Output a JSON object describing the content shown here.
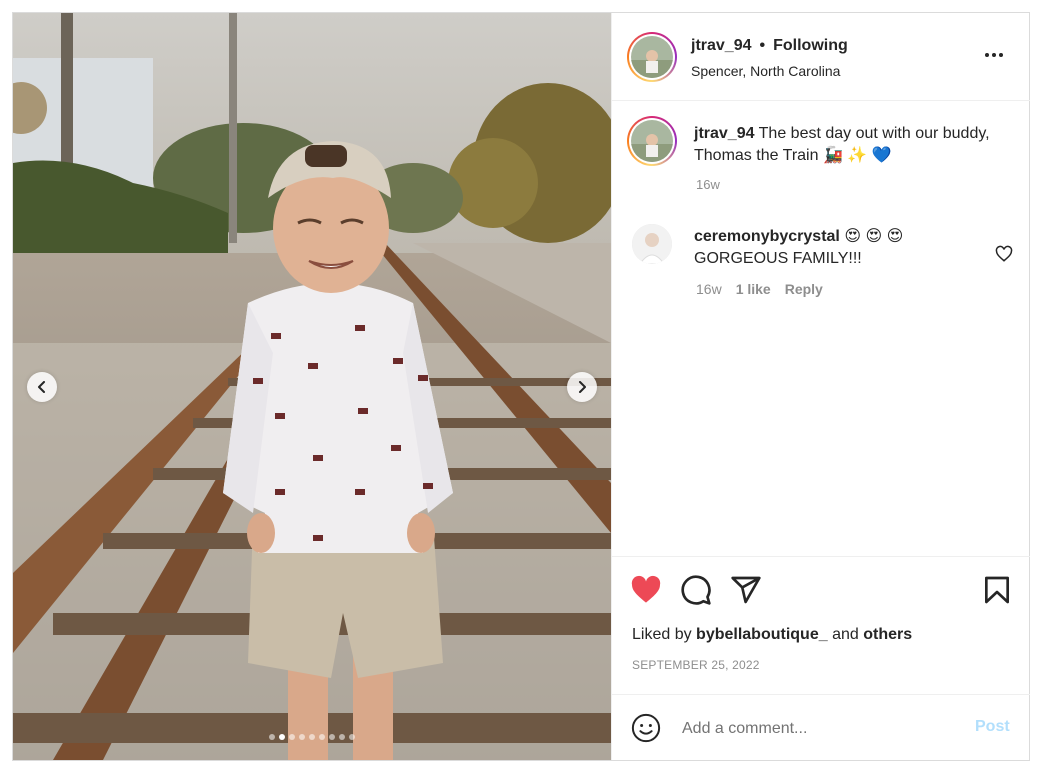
{
  "post": {
    "author": "jtrav_94",
    "separator": "•",
    "follow_status": "Following",
    "location": "Spencer, North Carolina",
    "more_icon": "more-horizontal-icon"
  },
  "caption": {
    "author": "jtrav_94",
    "text": "The best day out with our buddy, Thomas the Train 🚂 ✨ 💙",
    "time": "16w"
  },
  "comments": [
    {
      "user": "ceremonybycrystal",
      "emojis": "😍 😍 😍",
      "text": "GORGEOUS FAMILY!!!",
      "time": "16w",
      "likes": "1 like",
      "reply": "Reply"
    }
  ],
  "media": {
    "total_slides": 9,
    "active_slide": 2
  },
  "actions": {
    "like_icon": "heart-filled-icon",
    "comment_icon": "comment-icon",
    "share_icon": "share-icon",
    "save_icon": "bookmark-icon",
    "liked_color": "#ed4956"
  },
  "likes": {
    "prefix": "Liked by",
    "user": "bybellaboutique_",
    "connector": "and",
    "others": "others"
  },
  "date": "SEPTEMBER 25, 2022",
  "add_comment": {
    "placeholder": "Add a comment...",
    "post_label": "Post"
  }
}
